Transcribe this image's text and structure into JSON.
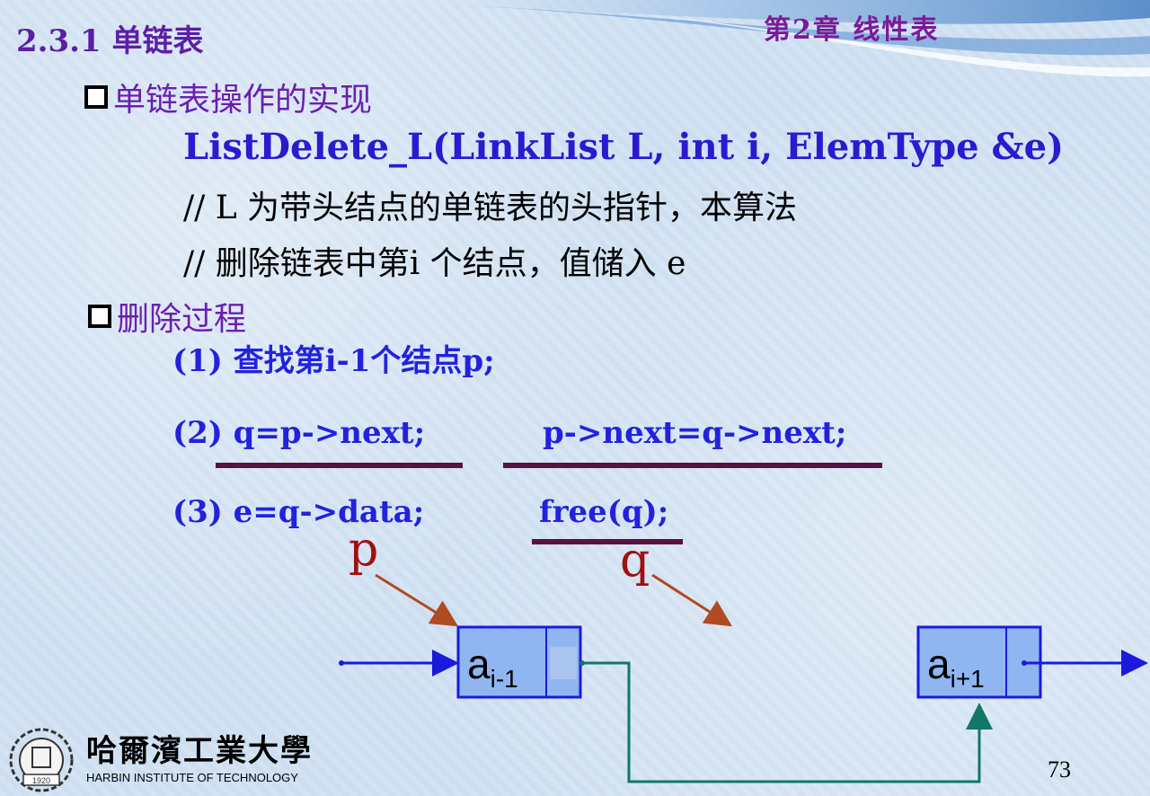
{
  "header": {
    "section_title": "2.3.1  单链表",
    "chapter": "第2章  线性表"
  },
  "heading1": "单链表操作的实现",
  "function_signature": "ListDelete_L(LinkList L, int i, ElemType &e)",
  "comment1": "// L 为带头结点的单链表的头指针，本算法",
  "comment2": "// 删除链表中第i 个结点，值储入 e",
  "heading2": "删除过程",
  "steps": {
    "s1": "(1) 查找第i-1个结点p;",
    "s2a": "(2) q=p->next;",
    "s2b": "p->next=q->next;",
    "s3a": "(3) e=q->data;",
    "s3b": "free(q);"
  },
  "diagram": {
    "p_label": "p",
    "q_label": "q",
    "node1_main": "a",
    "node1_sub": "i-1",
    "node2_main": "a",
    "node2_sub": "i+1"
  },
  "logo": {
    "cn": "哈爾濱工業大學",
    "en": "HARBIN INSTITUTE OF TECHNOLOGY",
    "year": "1920"
  },
  "page_number": "73",
  "colors": {
    "title_purple": "#5b1fa6",
    "code_blue": "#2a1ad0",
    "underline": "#5a1040",
    "pointer_red": "#a01010",
    "arrow_brown": "#b04a20",
    "link_teal": "#117766",
    "node_blue": "#1a1adc"
  }
}
